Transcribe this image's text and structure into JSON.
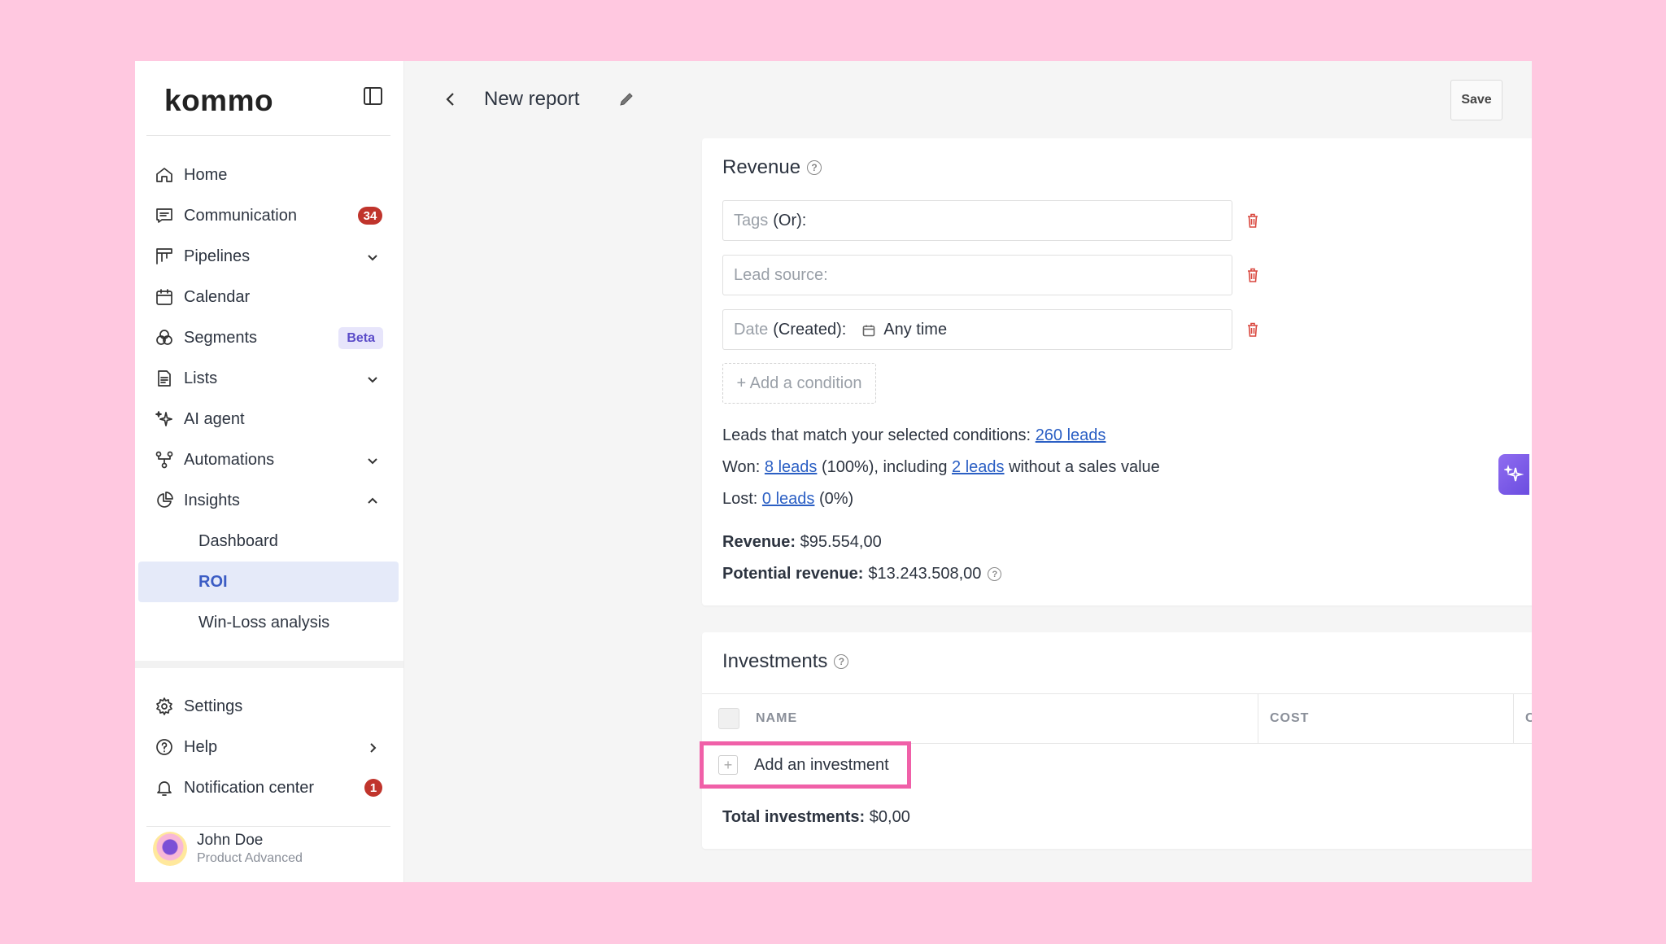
{
  "sidebar": {
    "logo": "kommo",
    "items": [
      {
        "label": "Home",
        "icon": "home-icon"
      },
      {
        "label": "Communication",
        "icon": "chat-icon",
        "badge": "34"
      },
      {
        "label": "Pipelines",
        "icon": "pipeline-icon",
        "expand": "chevron-down"
      },
      {
        "label": "Calendar",
        "icon": "calendar-icon"
      },
      {
        "label": "Segments",
        "icon": "segments-icon",
        "tag": "Beta"
      },
      {
        "label": "Lists",
        "icon": "document-icon",
        "expand": "chevron-down"
      },
      {
        "label": "AI agent",
        "icon": "sparkle-icon"
      },
      {
        "label": "Automations",
        "icon": "automation-icon",
        "expand": "chevron-down"
      },
      {
        "label": "Insights",
        "icon": "chart-pie-icon",
        "expand": "chevron-up"
      }
    ],
    "sub_items": [
      "Dashboard",
      "ROI",
      "Win-Loss analysis"
    ],
    "active_sub": "ROI",
    "bottom_items": [
      {
        "label": "Settings",
        "icon": "gear-icon"
      },
      {
        "label": "Help",
        "icon": "help-circle-icon",
        "expand": "chevron-right"
      },
      {
        "label": "Notification center",
        "icon": "bell-icon",
        "badge": "1"
      }
    ],
    "profile": {
      "name": "John Doe",
      "plan": "Product Advanced"
    }
  },
  "header": {
    "title": "New report",
    "save_label": "Save"
  },
  "revenue": {
    "title": "Revenue",
    "conditions": [
      {
        "label": "Tags",
        "qualifier": "(Or):",
        "value": ""
      },
      {
        "label": "Lead source:",
        "qualifier": "",
        "value": ""
      },
      {
        "label": "Date",
        "qualifier": "(Created):",
        "value": "Any time"
      }
    ],
    "add_condition": "+ Add a condition",
    "match_text": "Leads that match your selected conditions:",
    "match_link": "260 leads",
    "won_prefix": "Won:",
    "won_link": "8 leads",
    "won_mid": "(100%), including",
    "won_link2": "2 leads",
    "won_suffix": "without a sales value",
    "lost_prefix": "Lost:",
    "lost_link": "0 leads",
    "lost_suffix": "(0%)",
    "revenue_label": "Revenue:",
    "revenue_value": "$95.554,00",
    "potential_label": "Potential revenue:",
    "potential_value": "$13.243.508,00"
  },
  "investments": {
    "title": "Investments",
    "columns": [
      "NAME",
      "COST",
      "COST TYPE"
    ],
    "add_label": "Add an investment",
    "total_label": "Total investments:",
    "total_value": "$0,00"
  },
  "colors": {
    "background": "#ffc8e0",
    "accent": "#3b5cc4",
    "badge": "#c0342c",
    "highlight": "#f060a8",
    "trash": "#d9473e",
    "ai_button": "#7a5ce8"
  }
}
